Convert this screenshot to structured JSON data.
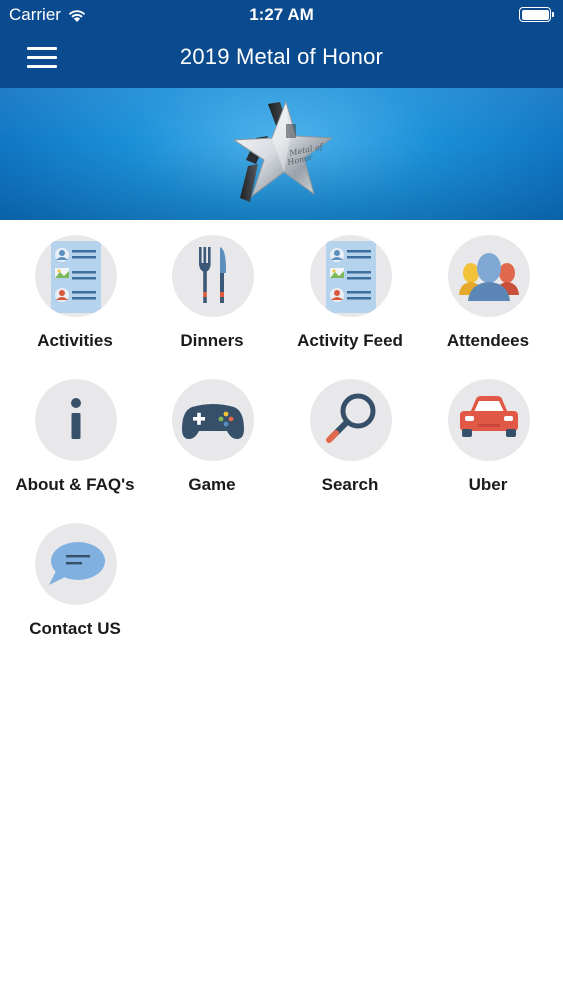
{
  "status_bar": {
    "carrier": "Carrier",
    "time": "1:27 AM",
    "wifi_icon": "wifi-icon",
    "battery_icon": "battery-icon"
  },
  "navbar": {
    "title": "2019 Metal of Honor",
    "menu_icon": "hamburger-menu-icon",
    "background_color": "#0a4a8f"
  },
  "banner": {
    "logo_icon": "silver-star-logo",
    "logo_text": "Metal of Honor"
  },
  "tiles": [
    {
      "label": "Activities",
      "icon": "activities-list-icon"
    },
    {
      "label": "Dinners",
      "icon": "fork-knife-icon"
    },
    {
      "label": "Activity Feed",
      "icon": "activity-feed-list-icon"
    },
    {
      "label": "Attendees",
      "icon": "people-group-icon"
    },
    {
      "label": "About & FAQ's",
      "icon": "info-icon"
    },
    {
      "label": "Game",
      "icon": "gamepad-icon"
    },
    {
      "label": "Search",
      "icon": "magnifier-icon"
    },
    {
      "label": "Uber",
      "icon": "car-icon"
    },
    {
      "label": "Contact US",
      "icon": "chat-bubble-icon"
    }
  ]
}
